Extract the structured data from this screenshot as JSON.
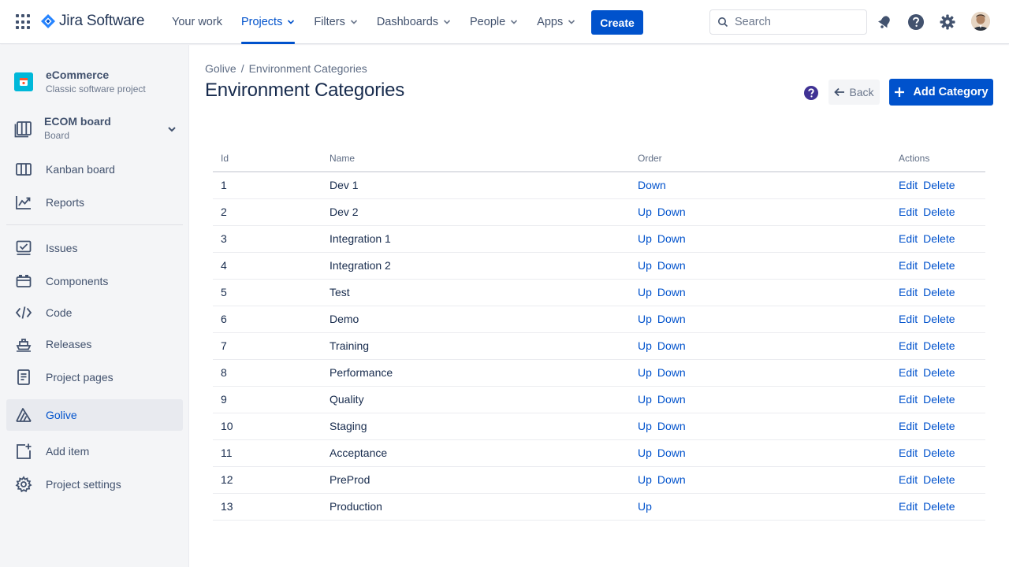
{
  "app": {
    "name": "Jira Software",
    "icons": {
      "switcher": "app-switcher-icon",
      "logo": "jira-logo-icon"
    }
  },
  "topnav": {
    "items": [
      {
        "label": "Your work",
        "dropdown": false,
        "active": false
      },
      {
        "label": "Projects",
        "dropdown": true,
        "active": true
      },
      {
        "label": "Filters",
        "dropdown": true,
        "active": false
      },
      {
        "label": "Dashboards",
        "dropdown": true,
        "active": false
      },
      {
        "label": "People",
        "dropdown": true,
        "active": false
      },
      {
        "label": "Apps",
        "dropdown": true,
        "active": false
      }
    ],
    "create_label": "Create",
    "search_placeholder": "Search",
    "icons": [
      "notifications-icon",
      "help-icon",
      "settings-icon",
      "avatar"
    ]
  },
  "sidebar": {
    "project": {
      "name": "eCommerce",
      "type": "Classic software project"
    },
    "board": {
      "name": "ECOM board",
      "type": "Board"
    },
    "items": [
      {
        "label": "Kanban board",
        "icon": "kanban-icon"
      },
      {
        "label": "Reports",
        "icon": "reports-icon"
      },
      {
        "label": "Issues",
        "icon": "issues-icon"
      },
      {
        "label": "Components",
        "icon": "components-icon"
      },
      {
        "label": "Code",
        "icon": "code-icon"
      },
      {
        "label": "Releases",
        "icon": "releases-icon"
      },
      {
        "label": "Project pages",
        "icon": "project-pages-icon"
      },
      {
        "label": "Golive",
        "icon": "golive-icon",
        "selected": true
      },
      {
        "label": "Add item",
        "icon": "add-item-icon"
      },
      {
        "label": "Project settings",
        "icon": "gear-icon"
      }
    ]
  },
  "main": {
    "breadcrumb": [
      "Golive",
      "Environment Categories"
    ],
    "title": "Environment Categories",
    "back_label": "Back",
    "add_label": "Add Category",
    "table": {
      "headers": [
        "Id",
        "Name",
        "Order",
        "Actions"
      ],
      "up_label": "Up",
      "down_label": "Down",
      "edit_label": "Edit",
      "delete_label": "Delete",
      "rows": [
        {
          "id": "1",
          "name": "Dev 1",
          "up": false,
          "down": true
        },
        {
          "id": "2",
          "name": "Dev 2",
          "up": true,
          "down": true
        },
        {
          "id": "3",
          "name": "Integration 1",
          "up": true,
          "down": true
        },
        {
          "id": "4",
          "name": "Integration 2",
          "up": true,
          "down": true
        },
        {
          "id": "5",
          "name": "Test",
          "up": true,
          "down": true
        },
        {
          "id": "6",
          "name": "Demo",
          "up": true,
          "down": true
        },
        {
          "id": "7",
          "name": "Training",
          "up": true,
          "down": true
        },
        {
          "id": "8",
          "name": "Performance",
          "up": true,
          "down": true
        },
        {
          "id": "9",
          "name": "Quality",
          "up": true,
          "down": true
        },
        {
          "id": "10",
          "name": "Staging",
          "up": true,
          "down": true
        },
        {
          "id": "11",
          "name": "Acceptance",
          "up": true,
          "down": true
        },
        {
          "id": "12",
          "name": "PreProd",
          "up": true,
          "down": true
        },
        {
          "id": "13",
          "name": "Production",
          "up": true,
          "down": false
        }
      ]
    }
  },
  "colors": {
    "brand": "#0052CC",
    "project_avatar": "#00B8D9",
    "help_icon": "#403294"
  }
}
